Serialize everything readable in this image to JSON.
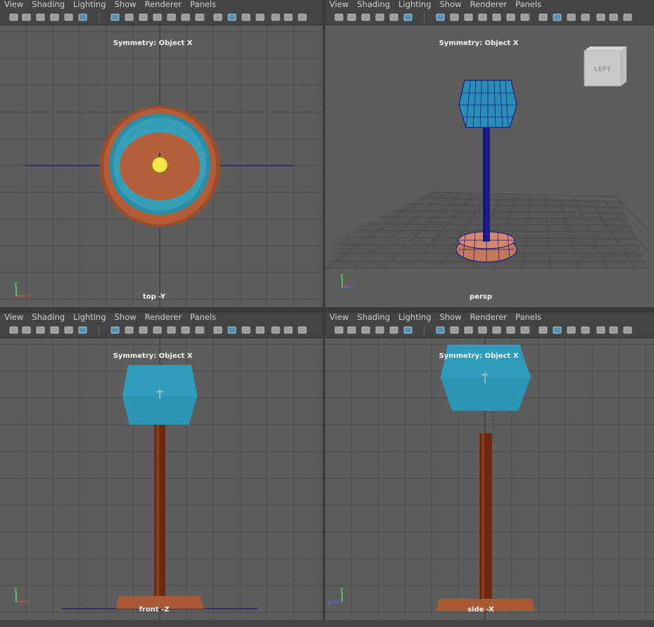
{
  "menu": [
    "View",
    "Shading",
    "Lighting",
    "Show",
    "Renderer",
    "Panels"
  ],
  "panels": {
    "top": {
      "symmetry": "Symmetry: Object X",
      "camera": "top -Y"
    },
    "persp": {
      "symmetry": "Symmetry: Object X",
      "camera": "persp",
      "view_cube": "LEFT"
    },
    "front": {
      "symmetry": "Symmetry: Object X",
      "camera": "front -Z"
    },
    "side": {
      "symmetry": "Symmetry: Object X",
      "camera": "side -X"
    }
  },
  "axes": {
    "top": {
      "up": "y",
      "right": "x"
    },
    "persp": {
      "up": "y",
      "right": "z"
    },
    "front": {
      "up": "y",
      "right": "x"
    },
    "side": {
      "up": "y",
      "right": "z"
    }
  },
  "toolbar_icons": [
    "camera-icon",
    "lock-camera-icon",
    "camera-attributes-icon",
    "bookmark-icon",
    "image-plane-icon",
    "grease-pencil-icon",
    "grid-icon",
    "film-gate-icon",
    "resolution-gate-icon",
    "gate-mask-icon",
    "field-chart-icon",
    "safe-action-icon",
    "safe-title-icon",
    "wireframe-icon",
    "smooth-shade-icon",
    "default-material-icon",
    "xray-icon",
    "lights-icon",
    "shadows-icon",
    "ambient-occlusion-icon"
  ],
  "colors": {
    "viewport_bg": "#5d5d5d",
    "grid": "#4a4a4a",
    "grid_axis": "#2f2f2f",
    "lamp_shade": "#2a97b0",
    "lamp_wood": "#a85a35",
    "pole": "#6b2a10",
    "wire": "#1a1a8c"
  }
}
